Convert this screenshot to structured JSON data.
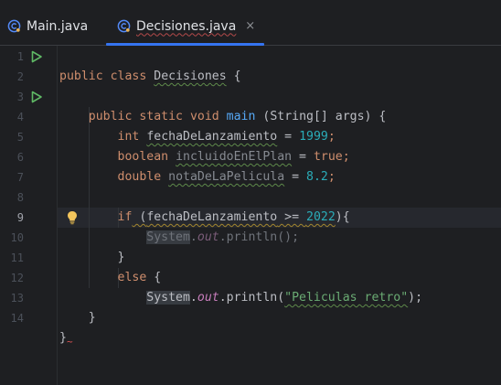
{
  "tabs": [
    {
      "label": "Main.java",
      "active": false
    },
    {
      "label": "Decisiones.java",
      "active": true,
      "close": "×"
    }
  ],
  "editor": {
    "line_numbers": [
      "1",
      "2",
      "3",
      "4",
      "5",
      "6",
      "7",
      "8",
      "9",
      "10",
      "11",
      "12",
      "13",
      "14"
    ],
    "active_line": "9",
    "code": {
      "l1": {
        "kw1": "public",
        "kw2": "class",
        "name": "Decisiones",
        "brace": "{"
      },
      "l3": {
        "kw1": "public",
        "kw2": "static",
        "kw3": "void",
        "fn": "main",
        "args": "(String[] args) {"
      },
      "l4": {
        "type": "int",
        "var": "fechaDeLanzamiento",
        "eq": " = ",
        "num": "1999",
        "end": ";"
      },
      "l5": {
        "type": "boolean",
        "var": "incluidoEnElPlan",
        "eq": " = ",
        "val": "true",
        "end": ";"
      },
      "l6": {
        "type": "double",
        "var": "notaDeLaPelicula",
        "eq": " = ",
        "num": "8.2",
        "end": ";"
      },
      "l8": {
        "kw": "if",
        "open": " (",
        "var": "fechaDeLanzamiento",
        "op": " >= ",
        "num": "2022",
        "close": "){"
      },
      "l9": {
        "sys": "System",
        "dot1": ".",
        "field": "out",
        "call": ".println();"
      },
      "l10": {
        "brace": "}"
      },
      "l11": {
        "kw": "else",
        "brace": " {"
      },
      "l12": {
        "sys": "System",
        "dot1": ".",
        "field": "out",
        "call1": ".println(",
        "str": "\"Peliculas retro\"",
        "call2": ");"
      },
      "l13": {
        "brace": "}"
      },
      "l14": {
        "brace": "}",
        "tilde": "~"
      }
    }
  },
  "colors": {
    "background": "#1e1f22",
    "keyword": "#cf8e6d",
    "method": "#56a8f5",
    "number": "#2aacb8",
    "string": "#6aab73",
    "field": "#c77dbb",
    "run": "#5fb865",
    "bulb": "#f2c55c",
    "tab_underline": "#3574f0"
  },
  "icons": {
    "tab_file": "java-class-icon",
    "run": "run-gutter-icon",
    "bulb": "lightbulb-icon"
  }
}
